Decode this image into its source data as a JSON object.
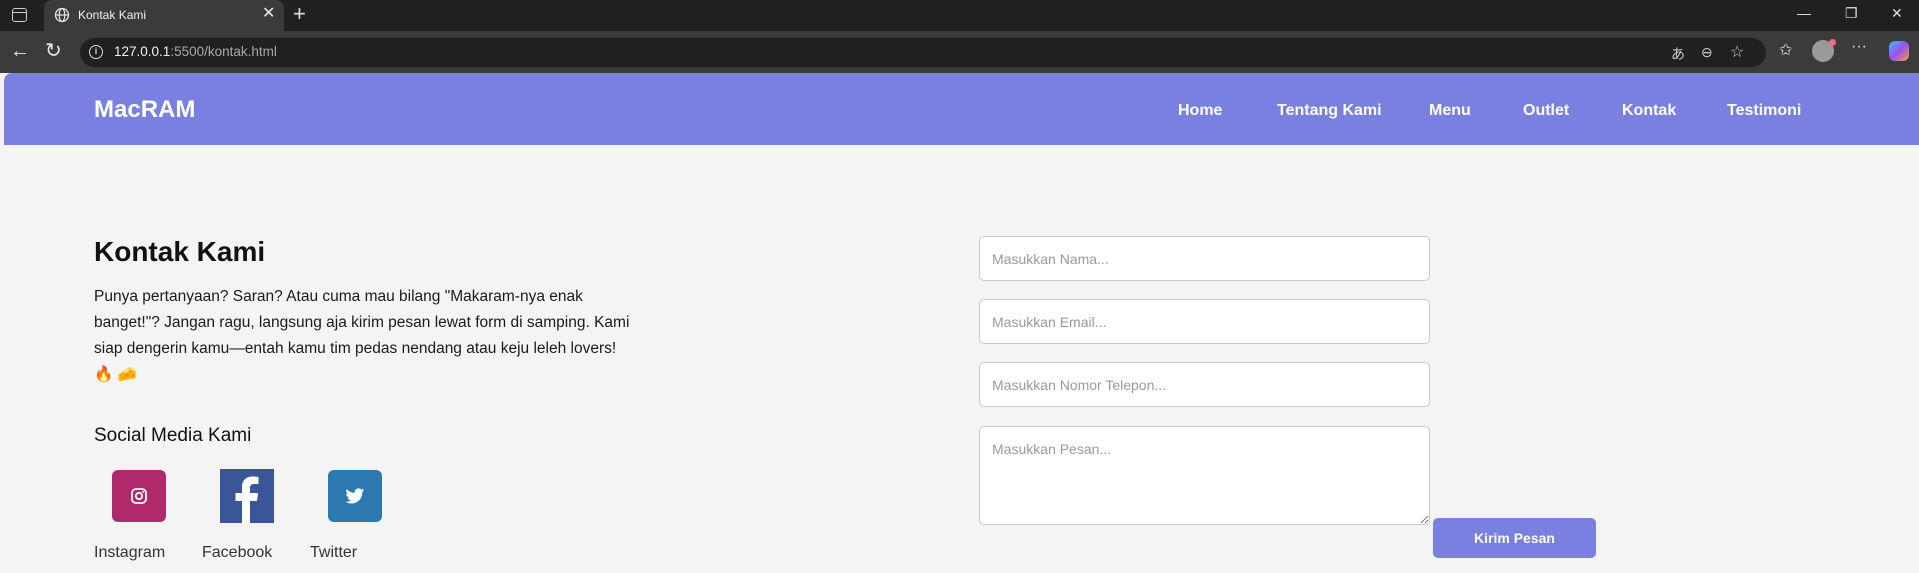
{
  "browser": {
    "tab_title": "Kontak Kami",
    "url_host": "127.0.0.1",
    "url_rest": ":5500/kontak.html"
  },
  "site": {
    "brand": "MacRAM",
    "nav": [
      "Home",
      "Tentang Kami",
      "Menu",
      "Outlet",
      "Kontak",
      "Testimoni"
    ]
  },
  "contact": {
    "title": "Kontak Kami",
    "intro": "Punya pertanyaan? Saran? Atau cuma mau bilang \"Makaram-nya enak banget!\"? Jangan ragu, langsung aja kirim pesan lewat form di samping. Kami siap dengerin kamu—entah kamu tim pedas nendang atau keju leleh lovers! 🔥 🧀",
    "social_title": "Social Media Kami",
    "social": [
      {
        "label": "Instagram",
        "icon": "instagram-icon",
        "color": "#b0296a"
      },
      {
        "label": "Facebook",
        "icon": "facebook-icon",
        "color": "#3b5698"
      },
      {
        "label": "Twitter",
        "icon": "twitter-icon",
        "color": "#2c79b0"
      }
    ]
  },
  "form": {
    "name_placeholder": "Masukkan Nama...",
    "email_placeholder": "Masukkan Email...",
    "phone_placeholder": "Masukkan Nomor Telepon...",
    "message_placeholder": "Masukkan Pesan...",
    "submit_label": "Kirim Pesan"
  },
  "colors": {
    "accent": "#7a80df",
    "page_bg": "#f4f4f4"
  }
}
